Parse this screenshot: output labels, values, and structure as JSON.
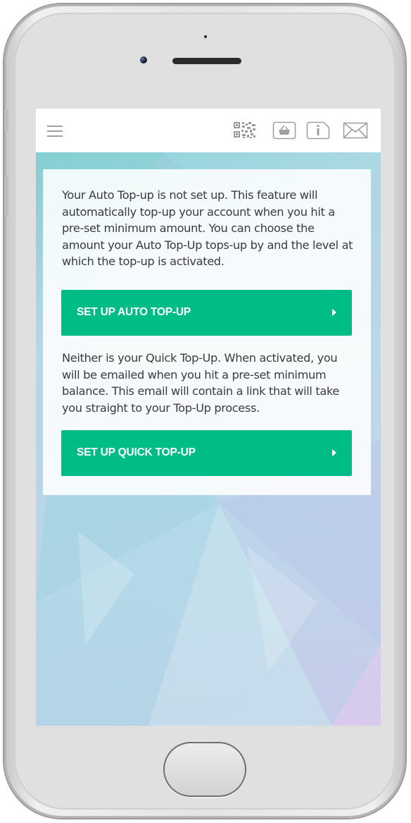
{
  "toolbar": {
    "menu_icon": "hamburger-menu-icon",
    "icons": [
      "qr-code-icon",
      "top-up-basket-icon",
      "info-icon",
      "mail-icon"
    ]
  },
  "card": {
    "auto_text": "Your Auto Top-up is not set up. This feature will automatically top-up your account when you hit a pre-set minimum amount. You can choose the amount your Auto Top-Up tops-up by and the level at which the top-up is activated.",
    "auto_button_label": "SET UP AUTO TOP-UP",
    "quick_text": "Neither is your Quick Top-Up. When activated, you will be emailed when you hit a pre-set minimum balance. This email will contain a link that will take you straight to your Top-Up process.",
    "quick_button_label": "SET UP QUICK TOP-UP"
  },
  "colors": {
    "accent": "#00bc86",
    "card_background": "#ffffff",
    "text": "#3b3b3b",
    "icon_gray": "#a0a0a0"
  }
}
